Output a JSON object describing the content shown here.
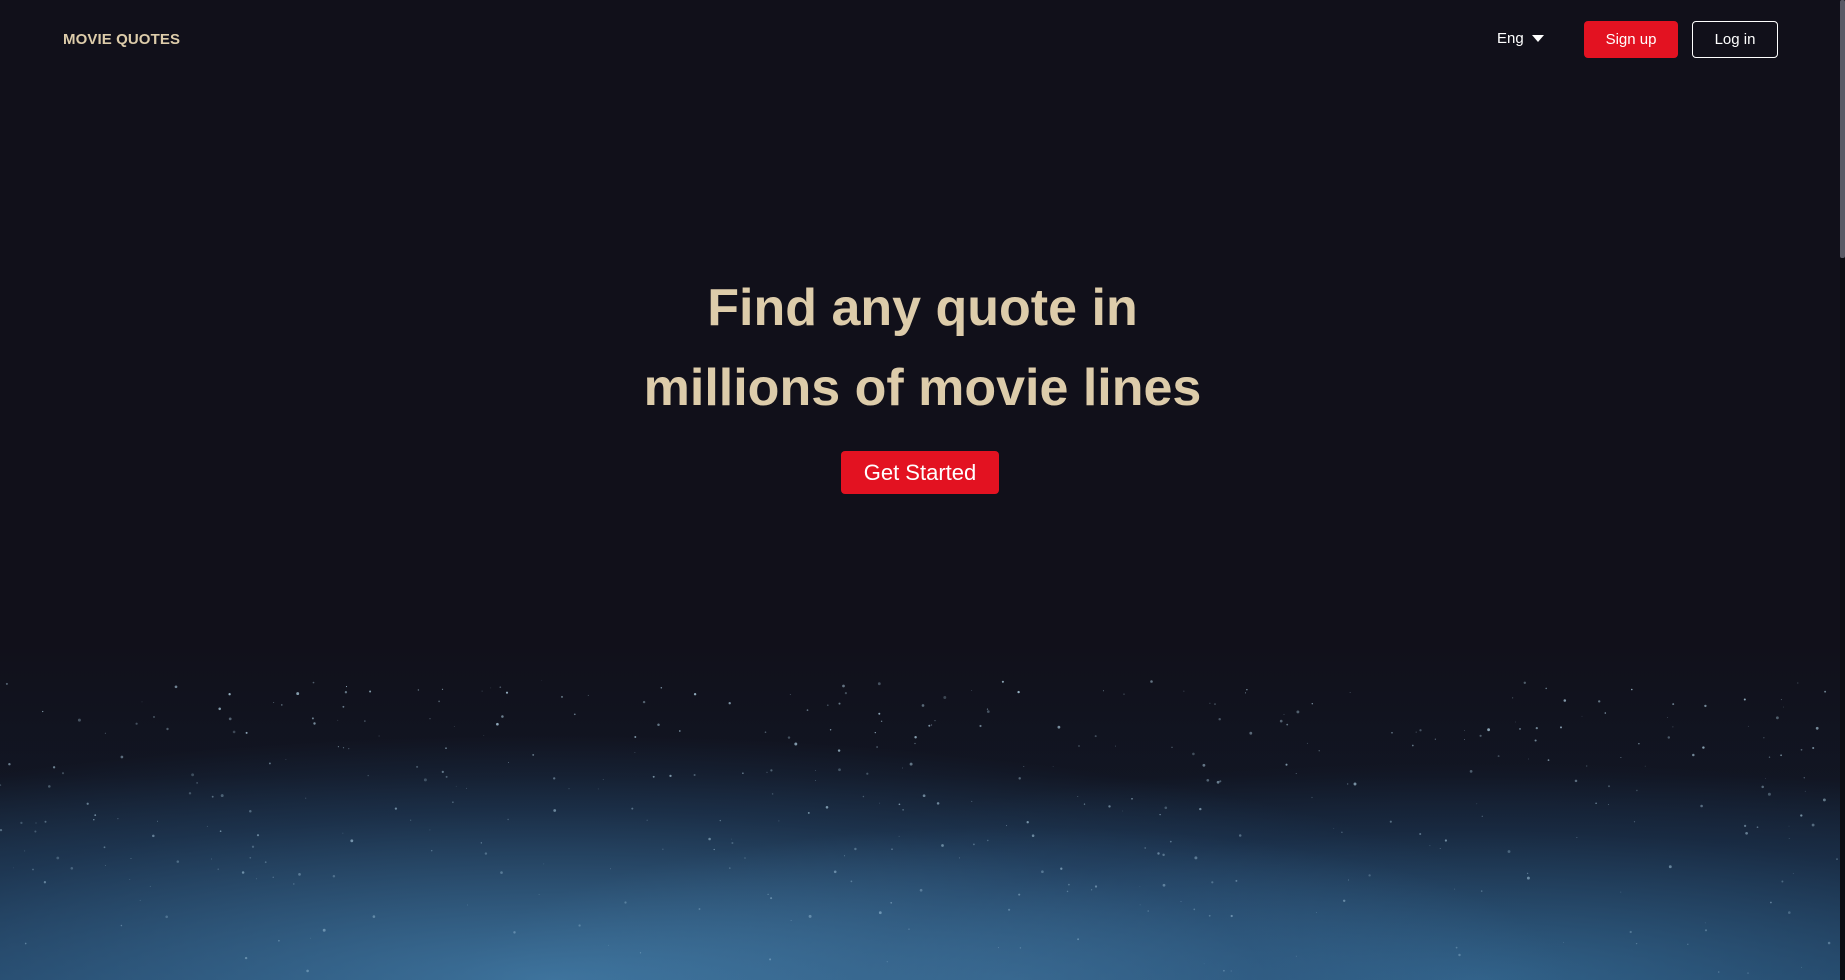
{
  "header": {
    "brand": "MOVIE QUOTES",
    "language": {
      "selected": "Eng",
      "icon": "caret-down-icon"
    },
    "signup_label": "Sign up",
    "login_label": "Log in"
  },
  "hero": {
    "title_line1": "Find any quote in",
    "title_line2": "millions of movie lines",
    "cta_label": "Get Started"
  },
  "colors": {
    "background": "#11101a",
    "accent": "#e31221",
    "heading": "#ddccaa",
    "text": "#ffffff"
  }
}
